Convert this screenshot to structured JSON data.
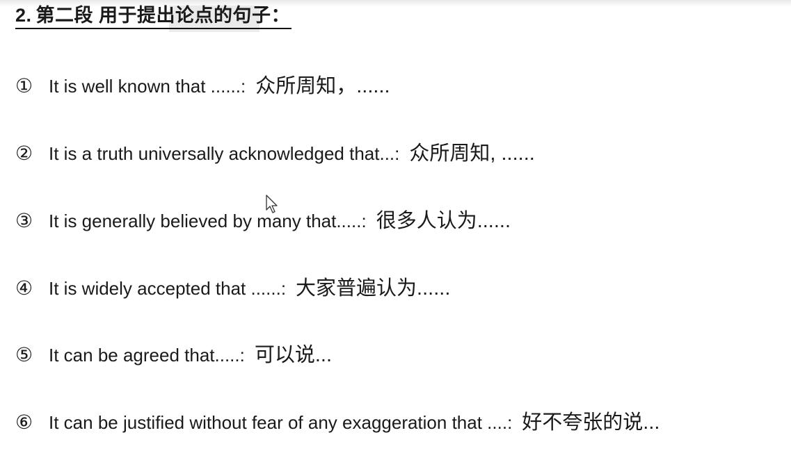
{
  "document": {
    "heading": {
      "number": "2.",
      "title": "第二段 用于提出论点的句子："
    },
    "items": [
      {
        "marker": "①",
        "english": "It is well known that ......:",
        "chinese": "众所周知，......"
      },
      {
        "marker": "②",
        "english": "It is a truth universally acknowledged that...:",
        "chinese": "众所周知, ......"
      },
      {
        "marker": "③",
        "english": "It is generally believed by many that.....:",
        "chinese": "很多人认为......"
      },
      {
        "marker": "④",
        "english": "It is widely accepted that ......:",
        "chinese": "大家普遍认为......"
      },
      {
        "marker": "⑤",
        "english": "It can be agreed that.....:",
        "chinese": "可以说..."
      },
      {
        "marker": "⑥",
        "english": "It can be justified without fear of any exaggeration that ....:",
        "chinese": "好不夸张的说..."
      }
    ]
  },
  "colors": {
    "text": "#1a1a1a",
    "background": "#ffffff",
    "highlight": "#d9d9d9"
  },
  "icons": {
    "cursor": "mouse-pointer-icon"
  }
}
